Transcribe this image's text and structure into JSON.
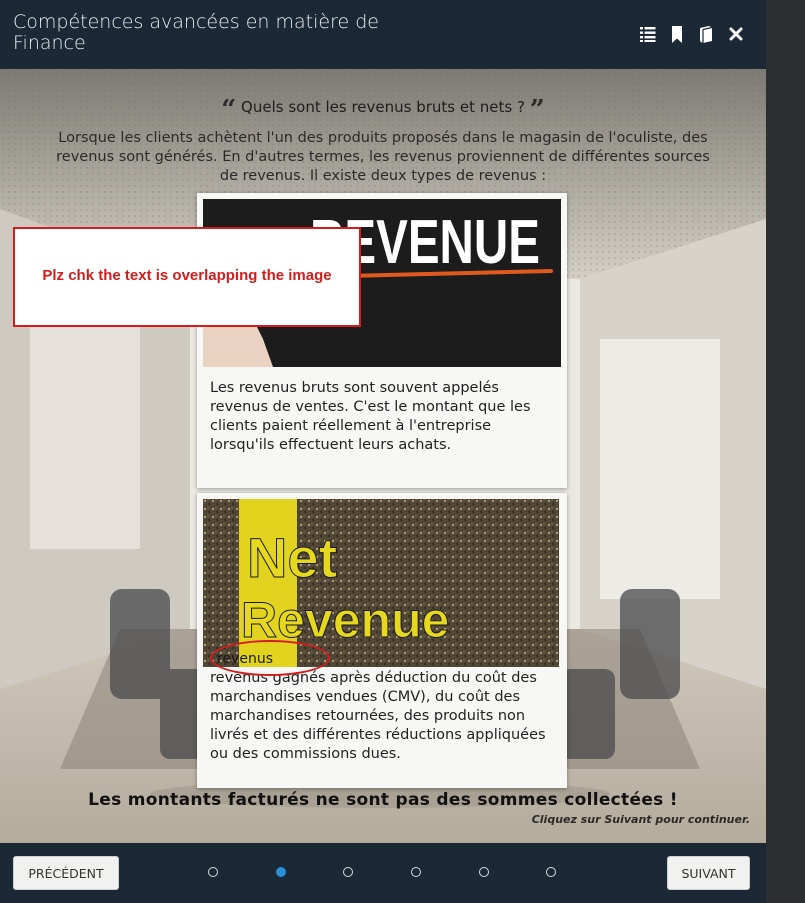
{
  "header": {
    "title": "Compétences avancées en matière de Finance",
    "icons": [
      "list-icon",
      "bookmark-icon",
      "book-icon",
      "close-icon"
    ]
  },
  "content": {
    "question": "Quels sont les revenus bruts et nets ?",
    "intro": "Lorsque les clients achètent l'un des produits proposés dans le magasin de l'oculiste, des revenus sont générés. En d'autres termes, les revenus proviennent de différentes sources de revenus. Il existe deux types de revenus :",
    "card1": {
      "image_text": "REVENUE",
      "text": "Les revenus bruts sont souvent appelés revenus de ventes. C'est le montant que les clients paient réellement à l'entreprise lorsqu'ils effectuent leurs achats."
    },
    "card2": {
      "image_line1": "Net",
      "image_line2": "Revenue",
      "overlap_word": "revenus",
      "text": "revenus gagnés après déduction du coût des marchandises vendues (CMV), du coût des marchandises retournées, des produits non livrés et des différentes réductions appliquées ou des commissions dues."
    },
    "annotation": "Plz chk the text is overlapping the image",
    "statement": "Les montants facturés ne sont pas des sommes collectées !",
    "continue_hint": "Cliquez sur Suivant pour continuer."
  },
  "nav": {
    "prev_label": "PRÉCÉDENT",
    "next_label": "SUIVANT",
    "dot_count": 6,
    "active_dot": 2
  },
  "colors": {
    "header_bg": "#1b2836",
    "accent": "#2b8fd6",
    "annotation_red": "#d41c1c"
  }
}
